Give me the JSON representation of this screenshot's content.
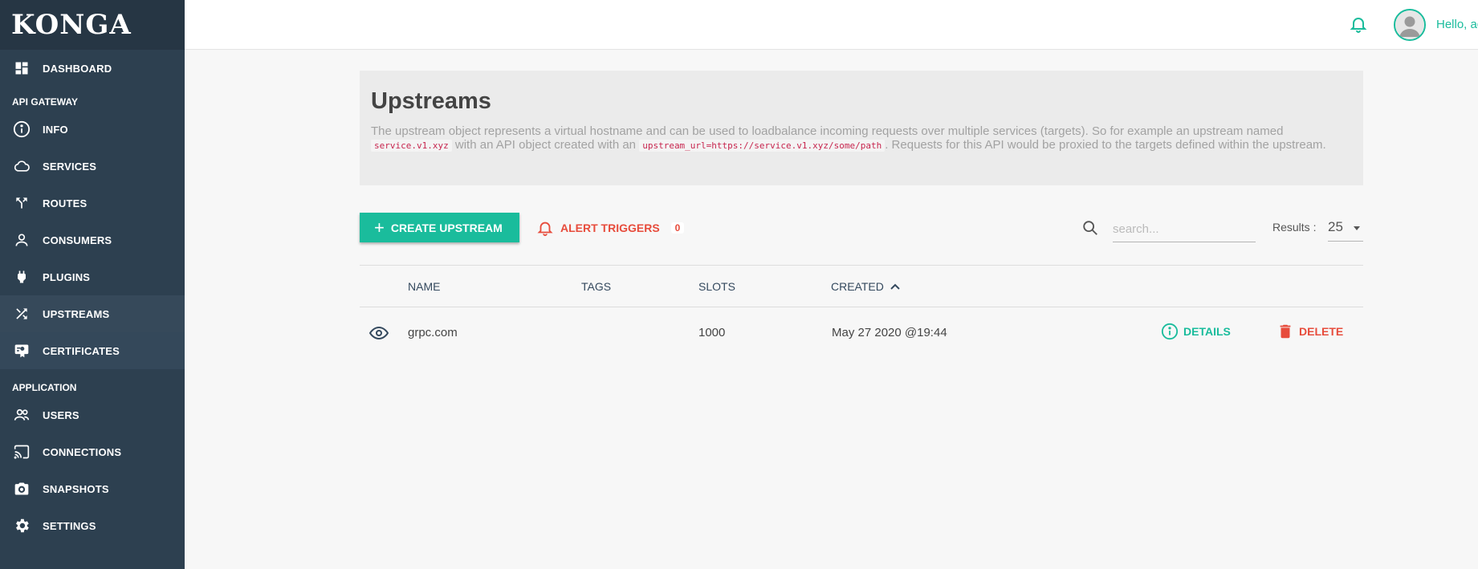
{
  "app": {
    "logo": "KONGA"
  },
  "sidebar": {
    "dashboard": "DASHBOARD",
    "section_api": "API GATEWAY",
    "api_items": [
      {
        "label": "INFO",
        "icon": "info-icon"
      },
      {
        "label": "SERVICES",
        "icon": "cloud-icon"
      },
      {
        "label": "ROUTES",
        "icon": "routes-icon"
      },
      {
        "label": "CONSUMERS",
        "icon": "person-icon"
      },
      {
        "label": "PLUGINS",
        "icon": "plug-icon"
      },
      {
        "label": "UPSTREAMS",
        "icon": "shuffle-icon"
      },
      {
        "label": "CERTIFICATES",
        "icon": "certificate-icon"
      }
    ],
    "section_app": "APPLICATION",
    "app_items": [
      {
        "label": "USERS",
        "icon": "users-icon"
      },
      {
        "label": "CONNECTIONS",
        "icon": "cast-icon"
      },
      {
        "label": "SNAPSHOTS",
        "icon": "camera-icon"
      },
      {
        "label": "SETTINGS",
        "icon": "gear-icon"
      }
    ]
  },
  "topbar": {
    "greeting": "Hello, ad"
  },
  "page": {
    "title": "Upstreams",
    "desc_1": "The upstream object represents a virtual hostname and can be used to loadbalance incoming requests over multiple services (targets). So for example an upstream named",
    "code_1": "service.v1.xyz",
    "desc_2": "with an API object created with an",
    "code_2": "upstream_url=https://service.v1.xyz/some/path",
    "desc_3": ". Requests for this API would be proxied to the targets defined within the upstream."
  },
  "toolbar": {
    "create_label": "CREATE UPSTREAM",
    "alert_label": "ALERT TRIGGERS",
    "alert_count": "0",
    "search_placeholder": "search...",
    "results_label": "Results :",
    "results_value": "25"
  },
  "table": {
    "headers": {
      "name": "NAME",
      "tags": "TAGS",
      "slots": "SLOTS",
      "created": "CREATED"
    },
    "rows": [
      {
        "name": "grpc.com",
        "tags": "",
        "slots": "1000",
        "created": "May 27 2020 @19:44",
        "details": "DETAILS",
        "delete": "DELETE"
      }
    ]
  },
  "colors": {
    "sidebar": "#2d4050",
    "accent": "#1abc9c",
    "danger": "#e74c3c"
  }
}
